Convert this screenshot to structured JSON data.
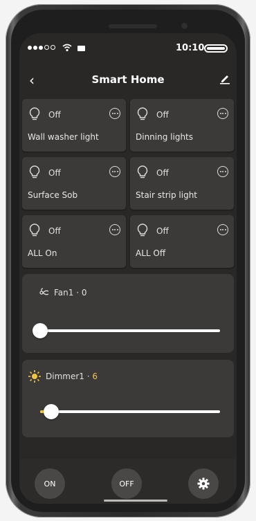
{
  "status": {
    "time": "10:10"
  },
  "nav": {
    "title": "Smart Home"
  },
  "devices": [
    {
      "state": "Off",
      "name": "Wall washer light"
    },
    {
      "state": "Off",
      "name": "Dinning lights"
    },
    {
      "state": "Off",
      "name": "Surface Sob"
    },
    {
      "state": "Off",
      "name": "Stair strip light"
    },
    {
      "state": "Off",
      "name": "ALL On"
    },
    {
      "state": "Off",
      "name": "ALL Off"
    }
  ],
  "fan": {
    "label": "Fan1 · ",
    "value": "0",
    "level": 0
  },
  "dimmer": {
    "label": "Dimmer1 · ",
    "value": "6",
    "level": 0.06
  },
  "bottom": {
    "on_label": "ON",
    "off_label": "OFF"
  },
  "colors": {
    "accent": "#f4c542",
    "card": "#3c3a39",
    "background": "#2a2827"
  }
}
